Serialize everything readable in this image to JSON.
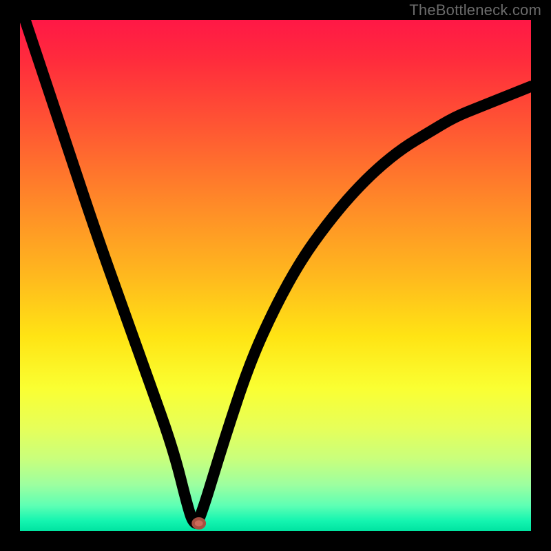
{
  "watermark": "TheBottleneck.com",
  "colors": {
    "gradient_top": "#ff1846",
    "gradient_mid": "#ffe414",
    "gradient_bottom": "#00e3a1",
    "curve": "#000000",
    "marker": "#cc6a5a",
    "frame": "#000000"
  },
  "chart_data": {
    "type": "line",
    "title": "",
    "xlabel": "",
    "ylabel": "",
    "xlim": [
      0,
      100
    ],
    "ylim": [
      0,
      100
    ],
    "grid": false,
    "legend": false,
    "annotations": [
      {
        "type": "marker",
        "x": 35,
        "y": 1.5,
        "label": ""
      }
    ],
    "series": [
      {
        "name": "bottleneck-curve",
        "x": [
          1,
          5,
          10,
          15,
          20,
          25,
          30,
          33,
          34,
          35,
          40,
          45,
          50,
          55,
          60,
          65,
          70,
          75,
          80,
          85,
          90,
          95,
          100
        ],
        "y": [
          100,
          88,
          73,
          58,
          44,
          30,
          16,
          4,
          1.5,
          1.5,
          18,
          33,
          44,
          53,
          60,
          66,
          71,
          75,
          78,
          81,
          83,
          85,
          87
        ]
      }
    ],
    "comment": "y-axis values read off the vertical position of the black curve relative to the 0–100 gradient; minimum sits at ~x=35."
  }
}
